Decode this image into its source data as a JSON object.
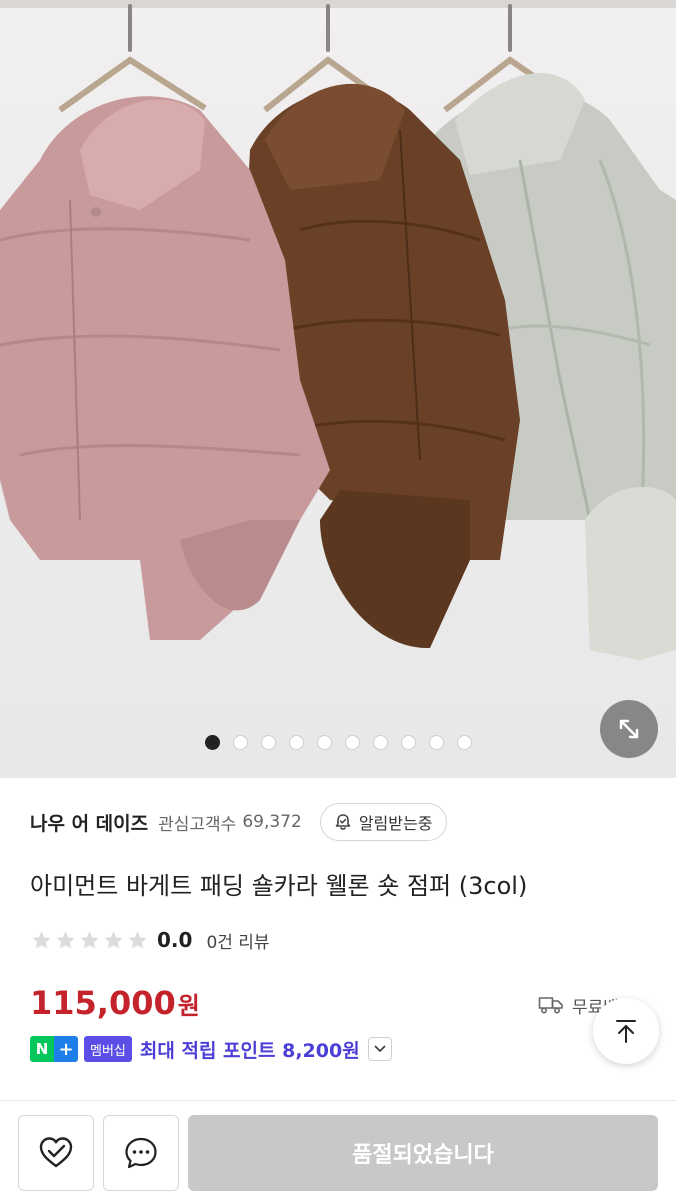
{
  "gallery": {
    "image_count": 10,
    "current_index": 1
  },
  "seller": {
    "name": "나우 어 데이즈",
    "followers_label": "관심고객수",
    "followers_count": "69,372",
    "notify_label": "알림받는중"
  },
  "product": {
    "title": "아미먼트 바게트 패딩 숄카라 웰론 숏 점퍼 (3col)",
    "rating": {
      "score": "0.0",
      "stars_filled": 0,
      "stars_total": 5,
      "reviews": "0건 리뷰"
    },
    "price": "115,000",
    "price_unit": "원",
    "shipping": "무료배송",
    "points": {
      "n_label": "N",
      "plus_label": "+",
      "membership_label": "멤버십",
      "text": "최대 적립 포인트 8,200원"
    }
  },
  "bottom_bar": {
    "soldout_label": "품절되었습니다"
  },
  "colors": {
    "price_red": "#c4232b",
    "points_purple": "#4b3fd6",
    "naver_green": "#03c75a",
    "plus_blue": "#1e7eea",
    "jacket_pink": "#c99a9b",
    "jacket_brown": "#6a4127",
    "jacket_sage": "#c7cbc3"
  },
  "icons": {
    "expand": "expand-arrows-icon",
    "bell": "bell-icon",
    "star": "star-icon",
    "truck": "truck-icon",
    "chevron": "chevron-down-icon",
    "top": "arrow-up-icon",
    "wishlist": "heart-icon",
    "chat": "chat-bubble-icon"
  }
}
